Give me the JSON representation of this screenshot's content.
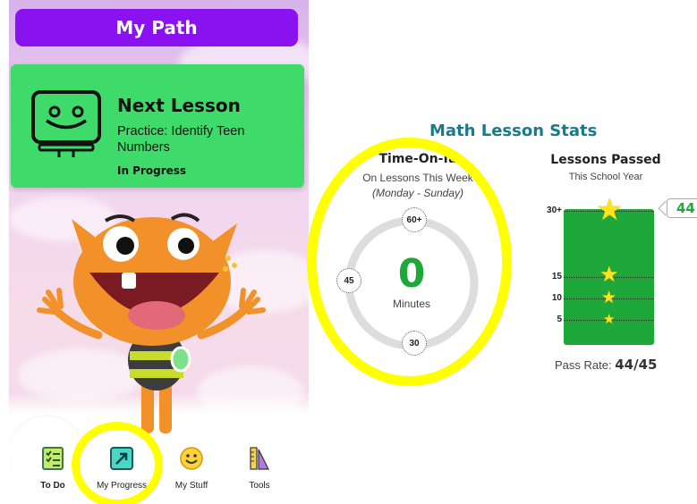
{
  "app": {
    "title": "My Path"
  },
  "next_lesson": {
    "title": "Next Lesson",
    "description": "Practice: Identify Teen Numbers",
    "status": "In Progress"
  },
  "nav": {
    "items": [
      {
        "label": "To Do",
        "icon": "checklist-icon"
      },
      {
        "label": "My Progress",
        "icon": "progress-arrow-icon"
      },
      {
        "label": "My Stuff",
        "icon": "smiley-icon"
      },
      {
        "label": "Tools",
        "icon": "ruler-triangle-icon"
      }
    ]
  },
  "stats": {
    "title": "Math Lesson Stats",
    "time_on_task": {
      "title": "Time-On-Ta",
      "subtitle": "On Lessons This Week",
      "range": "(Monday - Sunday)",
      "value": "0",
      "unit": "Minutes",
      "ticks": {
        "top": "60+",
        "left": "45",
        "bottom": "30"
      },
      "fill_fraction": 0
    },
    "lessons_passed": {
      "title": "Lessons Passed",
      "subtitle": "This School Year",
      "count": "44",
      "levels": [
        "30+",
        "15",
        "10",
        "5"
      ],
      "pass_rate_label": "Pass Rate:",
      "pass_rate_value": "44/45"
    }
  },
  "colors": {
    "title_bar": "#8a12f0",
    "lesson_card": "#3fdb6a",
    "stats_title": "#1a7a8c",
    "success_green": "#1fa83a",
    "highlight": "#ffff00",
    "star": "#ffe31a"
  }
}
